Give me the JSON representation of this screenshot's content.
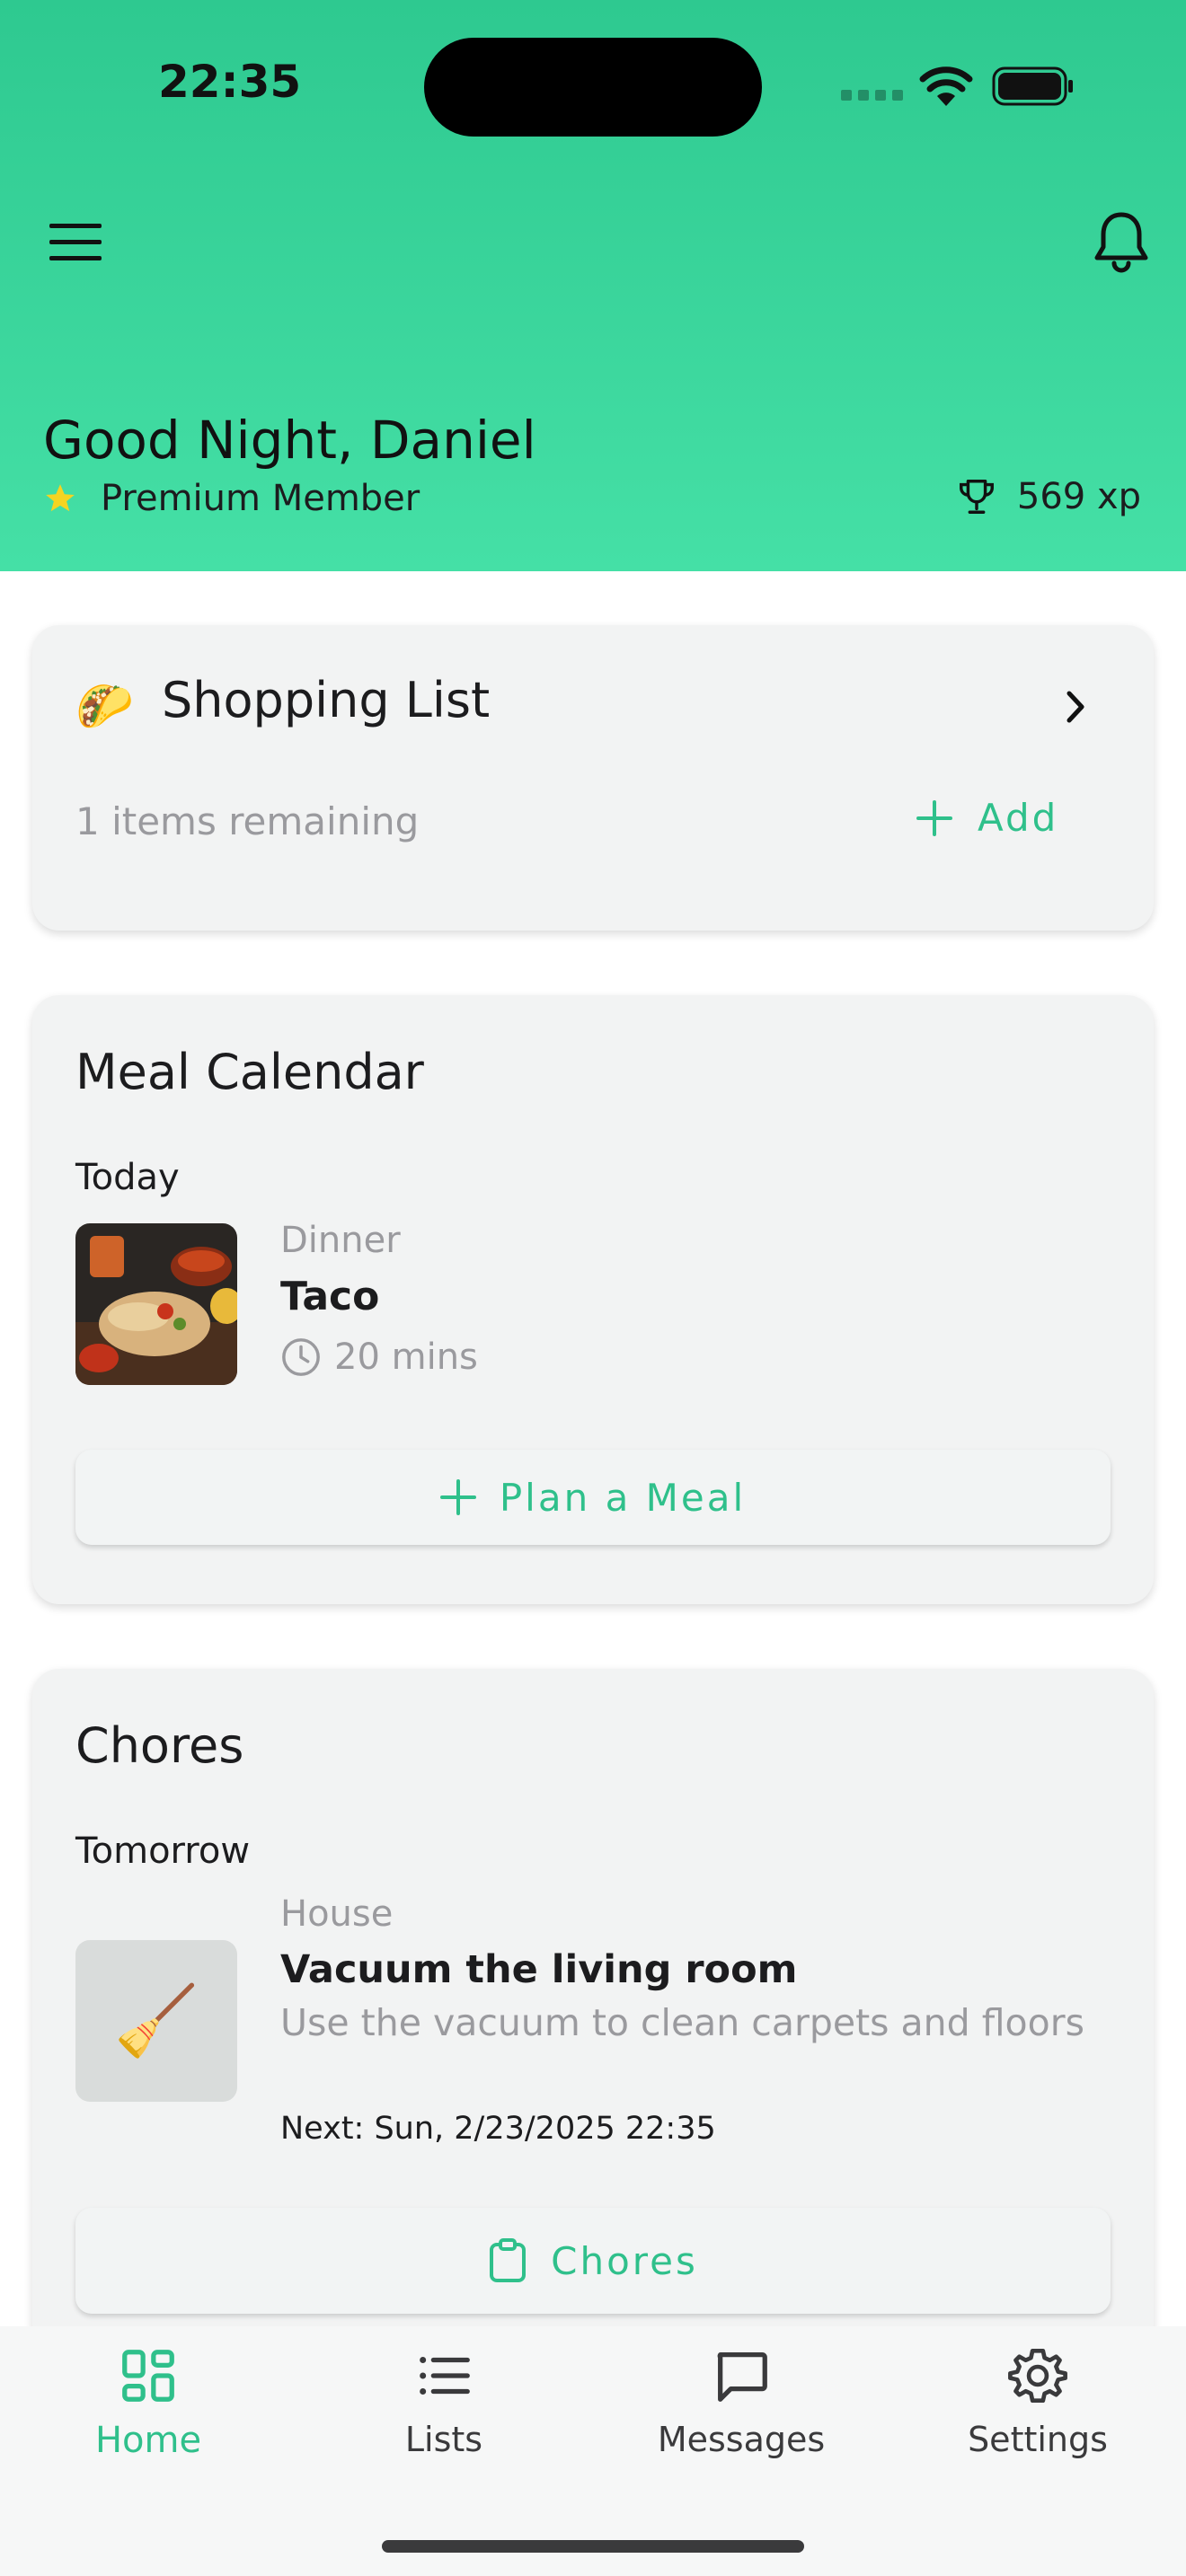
{
  "status_bar": {
    "time": "22:35"
  },
  "header": {
    "greeting": "Good Night, Daniel",
    "membership": "Premium Member",
    "xp": "569 xp",
    "menu_icon": "hamburger-menu-icon",
    "notification_icon": "bell-icon",
    "accent_color": "#2ec990"
  },
  "shopping_list": {
    "emoji": "🌮",
    "title": "Shopping List",
    "remaining": "1 items remaining",
    "add_label": "Add"
  },
  "meal_calendar": {
    "title": "Meal Calendar",
    "day": "Today",
    "meal_type": "Dinner",
    "meal_name": "Taco",
    "duration": "20 mins",
    "plan_button": "Plan a Meal"
  },
  "chores": {
    "title": "Chores",
    "day": "Tomorrow",
    "emoji": "🧹",
    "category": "House",
    "name": "Vacuum the living room",
    "description": "Use the vacuum to clean carpets and floors",
    "next": "Next: Sun, 2/23/2025 22:35",
    "button": "Chores"
  },
  "bottom_nav": {
    "items": [
      {
        "label": "Home",
        "icon": "grid-icon",
        "active": true
      },
      {
        "label": "Lists",
        "icon": "list-icon",
        "active": false
      },
      {
        "label": "Messages",
        "icon": "chat-bubble-icon",
        "active": false
      },
      {
        "label": "Settings",
        "icon": "gear-icon",
        "active": false
      }
    ]
  }
}
